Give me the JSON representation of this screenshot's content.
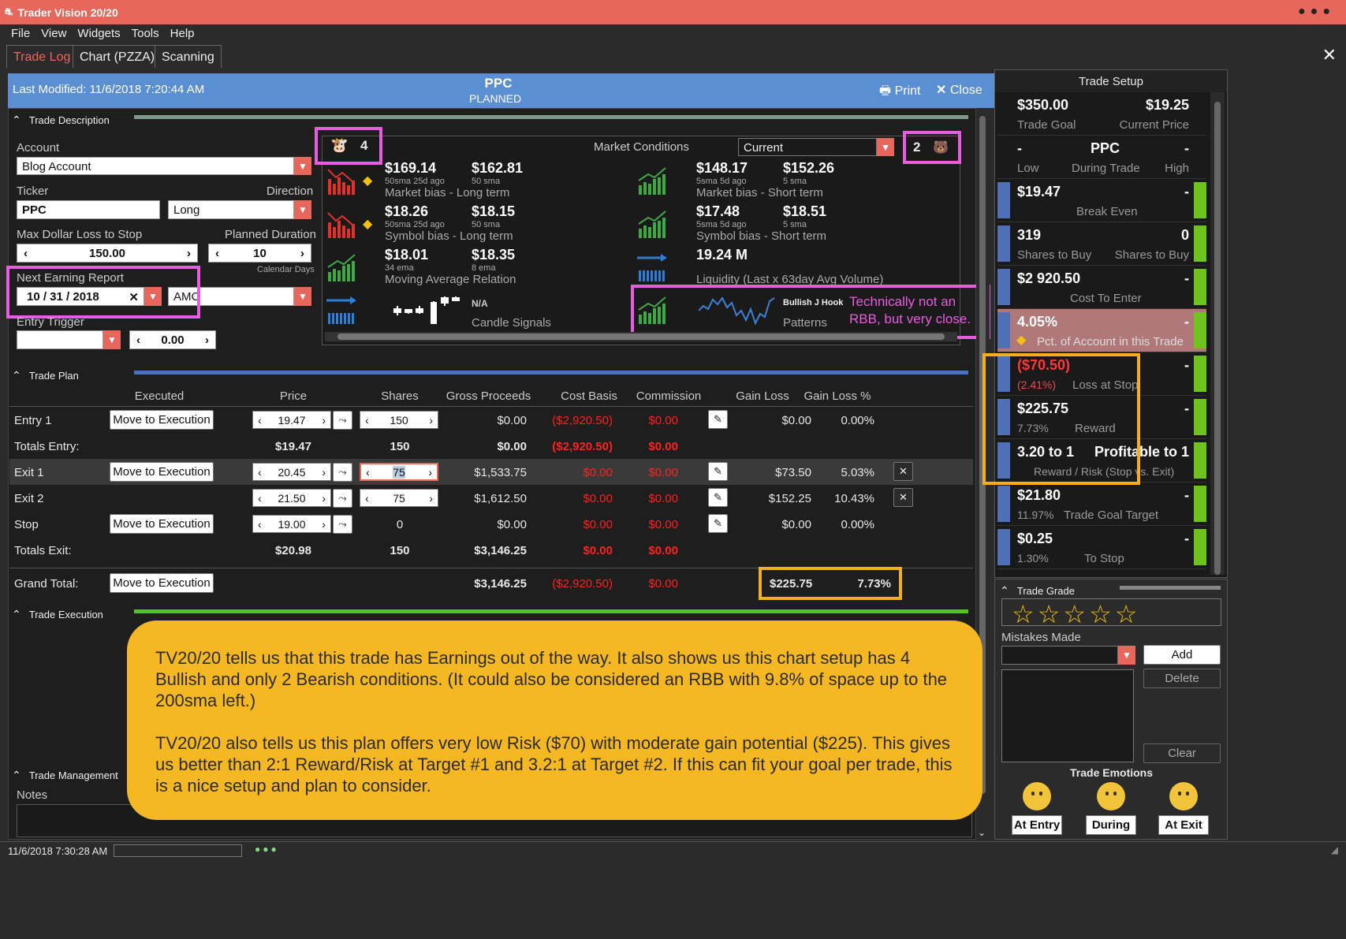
{
  "window": {
    "title": "Trader Vision 20/20"
  },
  "menu": [
    "File",
    "View",
    "Widgets",
    "Tools",
    "Help"
  ],
  "tabs": [
    "Trade Log",
    "Chart (PZZA)",
    "Scanning"
  ],
  "header": {
    "last_modified": "Last Modified: 11/6/2018 7:20:44 AM",
    "symbol": "PPC",
    "status": "PLANNED",
    "print": "Print",
    "close": "Close"
  },
  "description": {
    "title": "Trade Description",
    "account_label": "Account",
    "account": "Blog Account",
    "ticker_label": "Ticker",
    "ticker": "PPC",
    "direction_label": "Direction",
    "direction": "Long",
    "max_loss_label": "Max Dollar Loss to Stop",
    "max_loss": "150.00",
    "planned_label": "Planned Duration",
    "planned": "10",
    "calendar_days": "Calendar Days",
    "earning_label": "Next Earning Report",
    "earning_date": "10 / 31 / 2018",
    "earning_time": "AMC",
    "entry_trigger": "Entry Trigger",
    "trigger_value": "0.00"
  },
  "market": {
    "bull_count": "4",
    "bear_count": "2",
    "label": "Market Conditions",
    "select": "Current",
    "rows": [
      {
        "l1": "$169.14",
        "l1s": "50sma 25d ago",
        "l2": "$162.81",
        "l2s": "50 sma",
        "lcap": "Market bias - Long term",
        "r1": "$148.17",
        "r1s": "5sma 5d ago",
        "r2": "$152.26",
        "r2s": "5 sma",
        "rcap": "Market bias - Short term"
      },
      {
        "l1": "$18.26",
        "l1s": "50sma 25d ago",
        "l2": "$18.15",
        "l2s": "50 sma",
        "lcap": "Symbol bias - Long term",
        "r1": "$17.48",
        "r1s": "5sma 5d ago",
        "r2": "$18.51",
        "r2s": "5 sma",
        "rcap": "Symbol bias - Short term"
      },
      {
        "l1": "$18.01",
        "l1s": "34 ema",
        "l2": "$18.35",
        "l2s": "8 ema",
        "lcap": "Moving Average Relation",
        "r1": "19.24 M",
        "r1s": "",
        "r2": "",
        "r2s": "",
        "rcap": "Liquidity (Last x 63day Avg Volume)"
      }
    ],
    "candle_na": "N/A",
    "candle_cap": "Candle Signals",
    "pattern": "Bullish J Hook",
    "pattern_cap": "Patterns",
    "annotation": "Technically not an RBB, but very close."
  },
  "plan": {
    "title": "Trade Plan",
    "headers": [
      "Executed",
      "Price",
      "Shares",
      "Gross Proceeds",
      "Cost Basis",
      "Commission",
      "Gain Loss",
      "Gain Loss %"
    ],
    "move_label": "Move to Execution",
    "rows": [
      {
        "label": "Entry 1",
        "price": "19.47",
        "shares": "150",
        "gross": "$0.00",
        "cost": "($2,920.50)",
        "comm": "$0.00",
        "gain": "$0.00",
        "gainpct": "0.00%"
      },
      {
        "label": "Totals Entry:",
        "price": "$19.47",
        "shares": "150",
        "gross": "$0.00",
        "cost": "($2,920.50)",
        "comm": "$0.00"
      },
      {
        "label": "Exit 1",
        "price": "20.45",
        "shares": "75",
        "gross": "$1,533.75",
        "cost": "$0.00",
        "comm": "$0.00",
        "gain": "$73.50",
        "gainpct": "5.03%"
      },
      {
        "label": "Exit 2",
        "price": "21.50",
        "shares": "75",
        "gross": "$1,612.50",
        "cost": "$0.00",
        "comm": "$0.00",
        "gain": "$152.25",
        "gainpct": "10.43%"
      },
      {
        "label": "Stop",
        "price": "19.00",
        "shares": "0",
        "gross": "$0.00",
        "cost": "$0.00",
        "comm": "$0.00",
        "gain": "$0.00",
        "gainpct": "0.00%"
      },
      {
        "label": "Totals Exit:",
        "price": "$20.98",
        "shares": "150",
        "gross": "$3,146.25",
        "cost": "$0.00",
        "comm": "$0.00"
      }
    ],
    "grand_label": "Grand Total:",
    "grand_gross": "$3,146.25",
    "grand_cost": "($2,920.50)",
    "grand_comm": "$0.00",
    "grand_gain": "$225.75",
    "grand_pct": "7.73%"
  },
  "execution": {
    "title": "Trade Execution"
  },
  "management": {
    "title": "Trade Management",
    "notes": "Notes"
  },
  "callout": {
    "p1": "TV20/20 tells us that this trade has Earnings out of the way.  It also shows us this chart setup has 4 Bullish and only 2 Bearish conditions.  (It could also be considered an RBB with 9.8% of space up to the 200sma left.)",
    "p2": "TV20/20 also tells us this plan offers very low Risk ($70) with moderate gain potential ($225).  This gives us better than 2:1 Reward/Risk at Target #1 and 3.2:1 at Target #2.  If this can fit your goal per trade, this is a nice setup and plan to consider."
  },
  "setup": {
    "title": "Trade Setup",
    "goal": "$350.00",
    "goal_cap": "Trade Goal",
    "price": "$19.25",
    "price_cap": "Current Price",
    "low": "-",
    "low_cap": "Low",
    "sym": "PPC",
    "sym_cap": "During Trade",
    "high": "-",
    "high_cap": "High",
    "be": "$19.47",
    "be_cap": "Break Even",
    "dash": "-",
    "sb": "319",
    "sb_cap": "Shares to Buy",
    "sb2": "0",
    "sb2_cap": "Shares to Buy",
    "cost": "$2 920.50",
    "cost_cap": "Cost To Enter",
    "pct": "4.05%",
    "pct_cap": "Pct. of Account in this Trade",
    "loss": "($70.50)",
    "loss_pct": "(2.41%)",
    "loss_cap": "Loss at Stop",
    "reward": "$225.75",
    "reward_pct": "7.73%",
    "reward_cap": "Reward",
    "rr": "3.20 to 1",
    "rr2": "Profitable to 1",
    "rr_cap": "Reward / Risk (Stop vs. Exit)",
    "tg": "$21.80",
    "tg_pct": "11.97%",
    "tg_cap": "Trade Goal Target",
    "ts": "$0.25",
    "ts_pct": "1.30%",
    "ts_cap": "To Stop"
  },
  "grade": {
    "title": "Trade Grade",
    "stars": "☆☆☆☆☆",
    "mistakes": "Mistakes Made",
    "add": "Add",
    "delete": "Delete",
    "clear": "Clear",
    "emotions": "Trade Emotions",
    "at_entry": "At Entry",
    "during": "During",
    "at_exit": "At Exit"
  },
  "status": {
    "time": "11/6/2018 7:30:28 AM"
  }
}
